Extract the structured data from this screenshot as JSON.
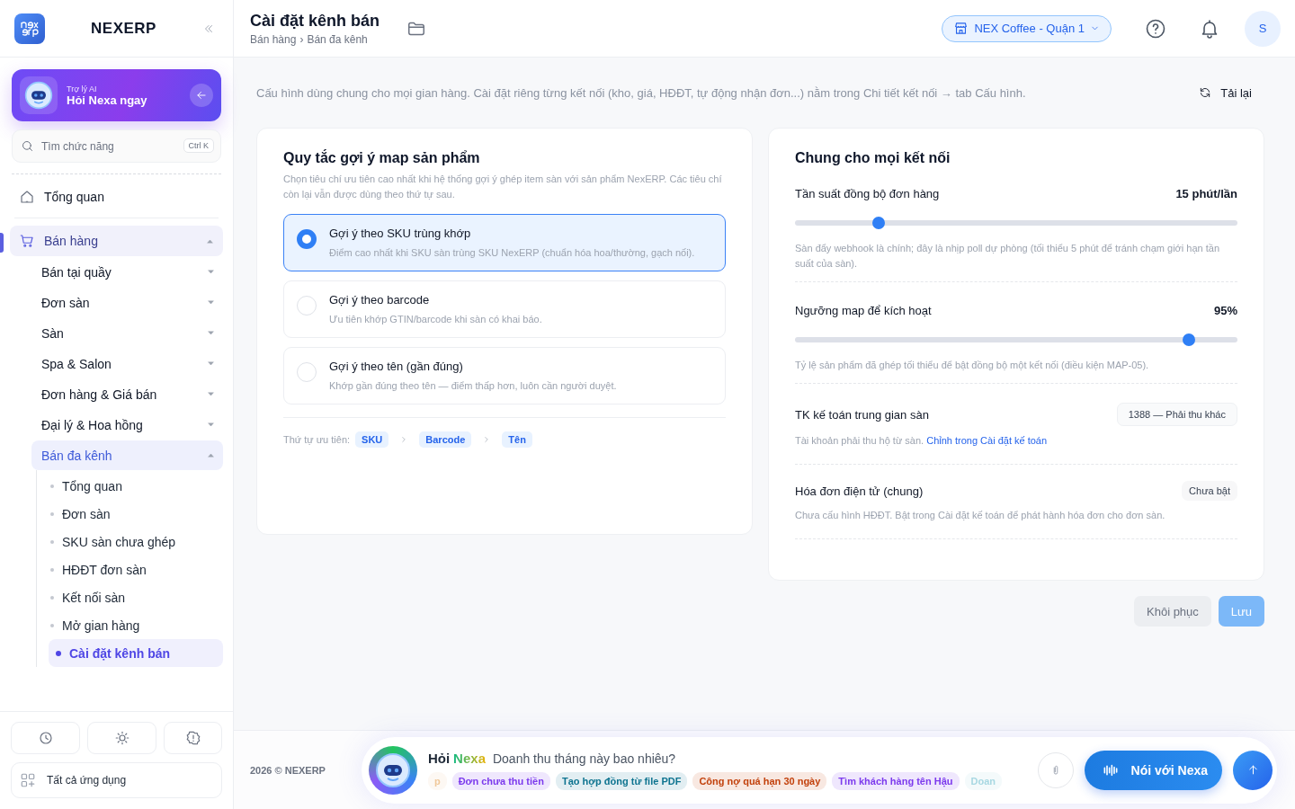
{
  "sidebar": {
    "brand": "NEXERP",
    "ai_card": {
      "caption": "Trợ lý AI",
      "title": "Hỏi Nexa ngay"
    },
    "search": {
      "placeholder": "Tìm chức năng",
      "shortcut": "Ctrl K"
    },
    "items": [
      {
        "label": "Tổng quan",
        "selected": false
      },
      {
        "label": "Bán hàng",
        "selected": true,
        "expanded": true,
        "children": [
          {
            "label": "Bán tại quầy",
            "selected": false,
            "expanded": false
          },
          {
            "label": "Đơn sàn",
            "selected": false,
            "expanded": false
          },
          {
            "label": "Sàn",
            "selected": false,
            "expanded": false
          },
          {
            "label": "Spa & Salon",
            "selected": false,
            "expanded": false
          },
          {
            "label": "Đơn hàng & Giá bán",
            "selected": false,
            "expanded": false
          },
          {
            "label": "Đại lý & Hoa hồng",
            "selected": false,
            "expanded": false
          },
          {
            "label": "Bán đa kênh",
            "selected": true,
            "expanded": true,
            "children": [
              {
                "label": "Tổng quan",
                "selected": false
              },
              {
                "label": "Đơn sàn",
                "selected": false
              },
              {
                "label": "SKU sàn chưa ghép",
                "selected": false
              },
              {
                "label": "HĐĐT đơn sàn",
                "selected": false
              },
              {
                "label": "Kết nối sàn",
                "selected": false
              },
              {
                "label": "Mở gian hàng",
                "selected": false
              },
              {
                "label": "Cài đặt kênh bán",
                "selected": true
              }
            ]
          }
        ]
      }
    ],
    "all_apps": "Tất cả ứng dụng"
  },
  "header": {
    "title": "Cài đặt kênh bán",
    "breadcrumb": [
      "Bán hàng",
      "Bán đa kênh"
    ],
    "breadcrumb_separator": "›",
    "store": "NEX Coffee - Quận 1",
    "avatar": "S"
  },
  "intro": {
    "text": "Cấu hình dùng chung cho mọi gian hàng. Cài đặt riêng từng kết nối (kho, giá, HĐĐT, tự động nhận đơn...) nằm trong Chi tiết kết nối → tab Cấu hình.",
    "reload": "Tải lại"
  },
  "mapping_card": {
    "title": "Quy tắc gợi ý map sản phẩm",
    "description": "Chọn tiêu chí ưu tiên cao nhất khi hệ thống gợi ý ghép item sàn với sản phẩm NexERP. Các tiêu chí còn lại vẫn được dùng theo thứ tự sau.",
    "options": [
      {
        "title": "Gợi ý theo SKU trùng khớp",
        "description": "Điểm cao nhất khi SKU sàn trùng SKU NexERP (chuẩn hóa hoa/thường, gạch nối).",
        "selected": true
      },
      {
        "title": "Gợi ý theo barcode",
        "description": "Ưu tiên khớp GTIN/barcode khi sàn có khai báo.",
        "selected": false
      },
      {
        "title": "Gợi ý theo tên (gần đúng)",
        "description": "Khớp gần đúng theo tên — điểm thấp hơn, luôn cần người duyệt.",
        "selected": false
      }
    ],
    "priority_label": "Thứ tự ưu tiên:",
    "priority": [
      "SKU",
      "Barcode",
      "Tên"
    ]
  },
  "general_card": {
    "title": "Chung cho mọi kết nối",
    "sliders": [
      {
        "label": "Tần suất đồng bộ đơn hàng",
        "value": "15 phút/lần",
        "level": 0.19,
        "hint": "Sàn đẩy webhook là chính; đây là nhịp poll dự phòng (tối thiểu 5 phút để tránh chạm giới hạn tần suất của sàn)."
      },
      {
        "label": "Ngưỡng map để kích hoạt",
        "value": "95%",
        "level": 0.89,
        "hint": "Tỷ lệ sản phẩm đã ghép tối thiểu để bật đồng bộ một kết nối (điều kiện MAP-05)."
      }
    ],
    "rows": [
      {
        "label": "TK kế toán trung gian sàn",
        "badge": "1388 — Phải thu khác",
        "hint": "Tài khoản phải thu hộ từ sàn.",
        "link": "Chỉnh trong Cài đặt kế toán"
      },
      {
        "label": "Hóa đơn điện tử (chung)",
        "badge": "Chưa bật",
        "hint": "Chưa cấu hình HĐĐT. Bật trong Cài đặt kế toán để phát hành hóa đơn cho đơn sàn."
      }
    ]
  },
  "actions": [
    {
      "label": "Khôi phục",
      "kind": "secondary"
    },
    {
      "label": "Lưu",
      "kind": "primary"
    }
  ],
  "footer": {
    "copyright": "2026 © NEXERP",
    "chat": {
      "ask": "Hỏi",
      "brand": "Nexa",
      "placeholder": "Doanh thu tháng này bao nhiêu?",
      "voice": "Nói với Nexa",
      "suggestions": [
        {
          "text": "p",
          "color": "#f0c89a"
        },
        {
          "text": "Đơn chưa thu tiền",
          "color": "#7c3aed"
        },
        {
          "text": "Tạo hợp đồng từ file PDF",
          "color": "#0e7490"
        },
        {
          "text": "Công nợ quá hạn 30 ngày",
          "color": "#c2410c"
        },
        {
          "text": "Tìm khách hàng tên Hậu",
          "color": "#7c3aed"
        },
        {
          "text": "Doan",
          "color": "#a8d8e2"
        }
      ]
    }
  }
}
